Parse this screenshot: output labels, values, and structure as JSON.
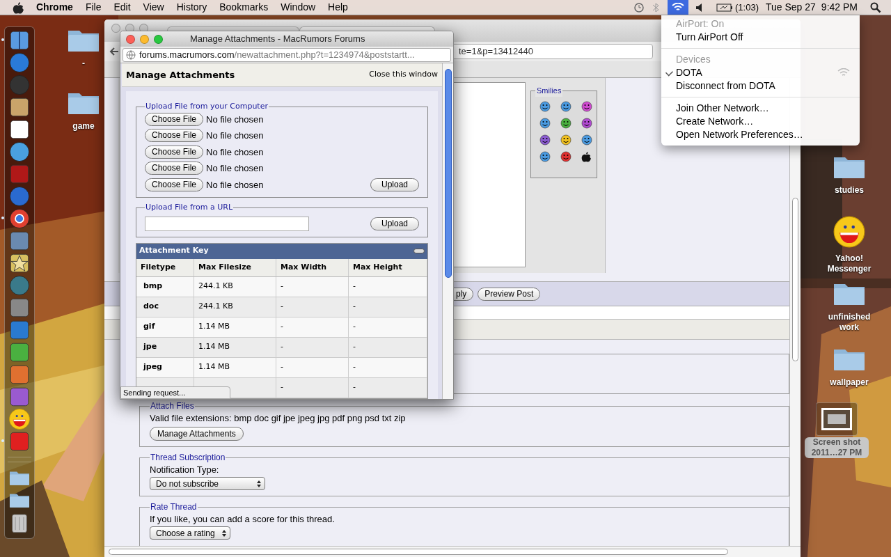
{
  "menubar": {
    "app": "Chrome",
    "menus": [
      "File",
      "Edit",
      "View",
      "History",
      "Bookmarks",
      "Window",
      "Help"
    ],
    "wifi_open": true,
    "battery": "(1:03)",
    "date": "Tue Sep 27",
    "time": "9:42 PM"
  },
  "airport_menu": {
    "items": [
      {
        "kind": "header",
        "label": "AirPort: On"
      },
      {
        "kind": "item",
        "label": "Turn AirPort Off",
        "checked": false
      },
      {
        "kind": "separator"
      },
      {
        "kind": "header",
        "label": "Devices"
      },
      {
        "kind": "network",
        "label": "DOTA",
        "checked": true
      },
      {
        "kind": "item",
        "label": "Disconnect from DOTA",
        "checked": false
      },
      {
        "kind": "separator"
      },
      {
        "kind": "item",
        "label": "Join Other Network…",
        "checked": false
      },
      {
        "kind": "item",
        "label": "Create Network…",
        "checked": false
      },
      {
        "kind": "item",
        "label": "Open Network Preferences…",
        "checked": false
      }
    ]
  },
  "dock": {
    "items": [
      {
        "kind": "app",
        "running": true
      },
      {
        "kind": "app",
        "running": false
      },
      {
        "kind": "app",
        "running": false
      },
      {
        "kind": "app",
        "running": false
      },
      {
        "kind": "app",
        "running": false
      },
      {
        "kind": "app",
        "running": false
      },
      {
        "kind": "app",
        "running": false
      },
      {
        "kind": "app",
        "running": false
      },
      {
        "kind": "app",
        "running": true
      },
      {
        "kind": "app",
        "running": false
      },
      {
        "kind": "app",
        "running": false
      },
      {
        "kind": "app",
        "running": false
      },
      {
        "kind": "app",
        "running": false
      },
      {
        "kind": "app",
        "running": false
      },
      {
        "kind": "app",
        "running": false
      },
      {
        "kind": "app",
        "running": false
      },
      {
        "kind": "app",
        "running": false
      },
      {
        "kind": "app",
        "running": false
      },
      {
        "kind": "app",
        "running": true
      },
      {
        "kind": "stack",
        "running": false
      },
      {
        "kind": "stack",
        "running": false
      },
      {
        "kind": "trash",
        "running": false
      }
    ]
  },
  "desktop": {
    "items": [
      {
        "kind": "folder",
        "label": "-",
        "selected": false
      },
      {
        "kind": "folder",
        "label": "game",
        "selected": false
      },
      {
        "kind": "folder",
        "label": "studies",
        "selected": false
      },
      {
        "kind": "messenger",
        "label": "Yahoo! Messenger",
        "selected": false
      },
      {
        "kind": "folder",
        "label": "unfinished work",
        "selected": false
      },
      {
        "kind": "folder",
        "label": "wallpaper",
        "selected": false
      },
      {
        "kind": "screenshot",
        "label": "Screen shot 2011…27 PM",
        "selected": true
      }
    ]
  },
  "browser": {
    "address_tail": "te=1&p=13412440",
    "smilies_legend": "Smilies",
    "buttons": [
      "ply",
      "Preview Post"
    ],
    "sections": [
      {
        "kind": "attach",
        "legend": "Attach Files",
        "text": "Valid file extensions: bmp doc gif jpe jpeg jpg pdf png psd txt zip",
        "button": "Manage Attachments"
      },
      {
        "kind": "select",
        "legend": "Thread Subscription",
        "label": "Notification Type:",
        "select": "Do not subscribe"
      },
      {
        "kind": "select",
        "legend": "Rate Thread",
        "label": "If you like, you can add a score for this thread.",
        "select": "Choose a rating"
      }
    ]
  },
  "popup": {
    "title": "Manage Attachments - MacRumors Forums",
    "url_host": "forums.macrumors.com",
    "url_path": "/newattachment.php?t=1234974&poststartt...",
    "heading": "Manage Attachments",
    "close_link": "Close this window",
    "computer_upload": {
      "legend": "Upload File from your Computer",
      "files": [
        {
          "button": "Choose File",
          "status": "No file chosen"
        },
        {
          "button": "Choose File",
          "status": "No file chosen"
        },
        {
          "button": "Choose File",
          "status": "No file chosen"
        },
        {
          "button": "Choose File",
          "status": "No file chosen"
        },
        {
          "button": "Choose File",
          "status": "No file chosen"
        }
      ],
      "upload": "Upload"
    },
    "url_upload": {
      "legend": "Upload File from a URL",
      "upload": "Upload"
    },
    "attachment_key": {
      "title": "Attachment Key",
      "columns": [
        "Filetype",
        "Max Filesize",
        "Max Width",
        "Max Height"
      ],
      "rows": [
        [
          "bmp",
          "244.1 KB",
          "-",
          "-"
        ],
        [
          "doc",
          "244.1 KB",
          "-",
          "-"
        ],
        [
          "gif",
          "1.14 MB",
          "-",
          "-"
        ],
        [
          "jpe",
          "1.14 MB",
          "-",
          "-"
        ],
        [
          "jpeg",
          "1.14 MB",
          "-",
          "-"
        ],
        [
          null,
          null,
          "-",
          "-"
        ]
      ]
    },
    "status": "Sending request..."
  }
}
